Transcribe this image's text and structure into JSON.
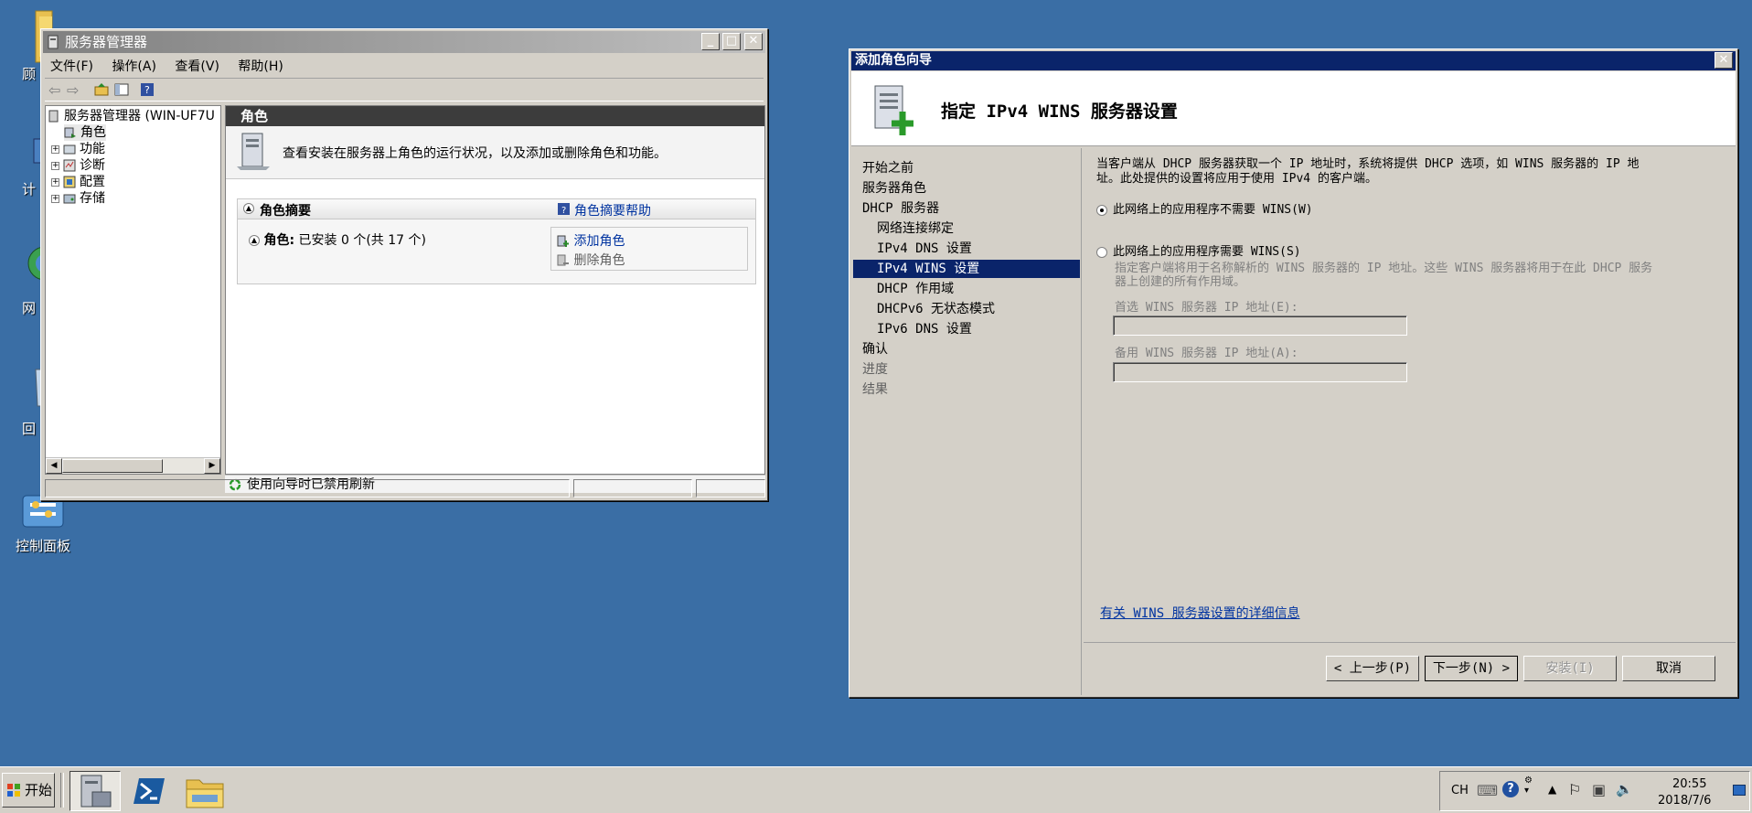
{
  "desktop": {
    "icons": [
      {
        "name": "folder",
        "label": "顾"
      },
      {
        "name": "computer",
        "label": "计"
      },
      {
        "name": "network",
        "label": "网"
      },
      {
        "name": "recycle-bin",
        "label": "回"
      },
      {
        "name": "control-panel",
        "label": "控制面板"
      }
    ]
  },
  "server_manager": {
    "title": "服务器管理器",
    "menus": [
      "文件(F)",
      "操作(A)",
      "查看(V)",
      "帮助(H)"
    ],
    "tree": {
      "root": "服务器管理器 (WIN-UF7U",
      "items": [
        "角色",
        "功能",
        "诊断",
        "配置",
        "存储"
      ]
    },
    "content_header": "角色",
    "description": "查看安装在服务器上角色的运行状况，以及添加或删除角色和功能。",
    "summary": {
      "title": "角色摘要",
      "help_link": "角色摘要帮助",
      "roles_label": "角色:",
      "roles_value": "已安装 0 个(共 17 个)",
      "add_role": "添加角色",
      "remove_role": "删除角色"
    },
    "status": "使用向导时已禁用刷新"
  },
  "wizard": {
    "title": "添加角色向导",
    "header_title": "指定 IPv4 WINS 服务器设置",
    "nav": [
      {
        "label": "开始之前",
        "level": 0,
        "state": "normal"
      },
      {
        "label": "服务器角色",
        "level": 0,
        "state": "normal"
      },
      {
        "label": "DHCP 服务器",
        "level": 0,
        "state": "normal"
      },
      {
        "label": "网络连接绑定",
        "level": 1,
        "state": "normal"
      },
      {
        "label": "IPv4 DNS 设置",
        "level": 1,
        "state": "normal"
      },
      {
        "label": "IPv4 WINS 设置",
        "level": 1,
        "state": "selected"
      },
      {
        "label": "DHCP 作用域",
        "level": 1,
        "state": "normal"
      },
      {
        "label": "DHCPv6 无状态模式",
        "level": 1,
        "state": "normal"
      },
      {
        "label": "IPv6 DNS 设置",
        "level": 1,
        "state": "normal"
      },
      {
        "label": "确认",
        "level": 0,
        "state": "normal"
      },
      {
        "label": "进度",
        "level": 0,
        "state": "disabled"
      },
      {
        "label": "结果",
        "level": 0,
        "state": "disabled"
      }
    ],
    "intro_line1": "当客户端从 DHCP 服务器获取一个 IP 地址时，系统将提供 DHCP 选项，如 WINS 服务器的 IP 地",
    "intro_line2": "址。此处提供的设置将应用于使用 IPv4 的客户端。",
    "option_not_required": "此网络上的应用程序不需要 WINS(W)",
    "option_required": "此网络上的应用程序需要 WINS(S)",
    "required_desc_line1": "指定客户端将用于名称解析的 WINS 服务器的 IP 地址。这些 WINS 服务器将用于在此 DHCP 服务",
    "required_desc_line2": "器上创建的所有作用域。",
    "preferred_label": "首选 WINS 服务器 IP 地址(E):",
    "preferred_value": "",
    "alternate_label": "备用 WINS 服务器 IP 地址(A):",
    "alternate_value": "",
    "more_info_link": "有关 WINS 服务器设置的详细信息",
    "buttons": {
      "back": "< 上一步(P)",
      "next": "下一步(N) >",
      "install": "安装(I)",
      "cancel": "取消"
    }
  },
  "taskbar": {
    "start": "开始",
    "tray": {
      "lang": "CH",
      "time": "20:55",
      "date": "2018/7/6"
    }
  }
}
